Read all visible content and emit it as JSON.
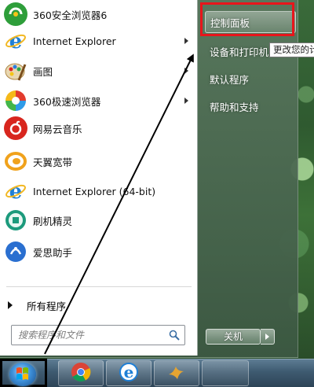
{
  "programs": [
    {
      "label": "360安全浏览器6",
      "icon": "360-safe-browser-icon",
      "color": "#2e9e3a",
      "has_arrow": false
    },
    {
      "label": "Internet Explorer",
      "icon": "internet-explorer-icon",
      "color": "#1e7fd6",
      "has_arrow": true
    },
    {
      "label": "画图",
      "icon": "paint-icon",
      "color": "#e9a23b",
      "has_arrow": true
    },
    {
      "label": "360极速浏览器",
      "icon": "360-speed-browser-icon",
      "color": "#d9372a",
      "has_arrow": true
    },
    {
      "label": "网易云音乐",
      "icon": "netease-music-icon",
      "color": "#d8261e",
      "has_arrow": false
    },
    {
      "label": "天翼宽带",
      "icon": "tianyi-broadband-icon",
      "color": "#f0a21c",
      "has_arrow": false
    },
    {
      "label": "Internet Explorer (64-bit)",
      "icon": "internet-explorer-64-icon",
      "color": "#1e7fd6",
      "has_arrow": false
    },
    {
      "label": "刷机精灵",
      "icon": "flash-wizard-icon",
      "color": "#1c9a7c",
      "has_arrow": false
    },
    {
      "label": "爱思助手",
      "icon": "aisi-assistant-icon",
      "color": "#2a6fd0",
      "has_arrow": false
    }
  ],
  "all_programs": "所有程序",
  "search": {
    "placeholder": "搜索程序和文件"
  },
  "right_pane": {
    "items": [
      "控制面板",
      "设备和打印机",
      "默认程序",
      "帮助和支持"
    ]
  },
  "tooltip": "更改您的计",
  "shutdown_label": "关机",
  "colors": {
    "highlight": "#e8151b",
    "accent": "#2f5a30"
  }
}
